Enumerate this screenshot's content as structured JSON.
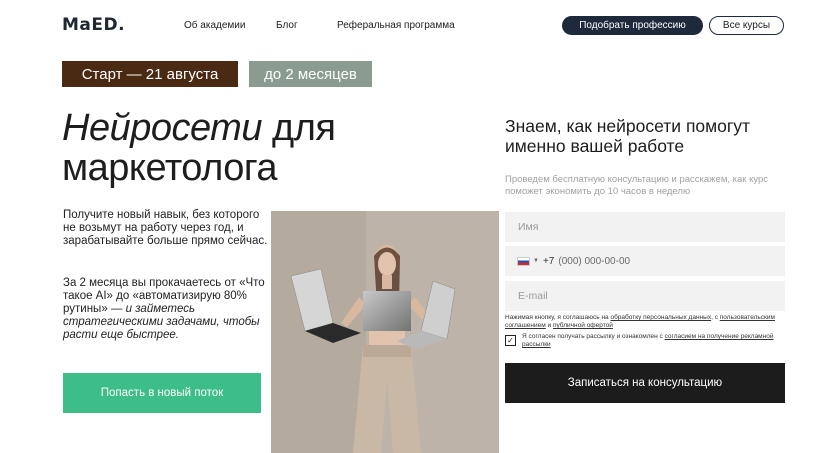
{
  "header": {
    "logo": "MaED.",
    "nav": [
      "Об академии",
      "Блог",
      "Реферальная программа"
    ],
    "choose_profession": "Подобрать профессию",
    "all_courses": "Все курсы"
  },
  "tags": {
    "start": "Старт —  21 августа",
    "duration": "до 2 месяцев"
  },
  "hero": {
    "title_italic": "Нейросети",
    "title_rest": " для",
    "title_line2": "маркетолога",
    "intro": "Получите новый навык, без которого не возьмут на работу через год, и зарабатывайте больше прямо сейчас.",
    "intro2_plain": "За 2 месяца вы прокачаетесь от «Что такое AI» до «автоматизирую 80% рутины» — ",
    "intro2_italic": "и займетесь стратегическими задачами, чтобы расти еще быстрее.",
    "cta": "Попасть в новый поток"
  },
  "form": {
    "title": "Знаем, как нейросети помогут именно вашей работе",
    "subtitle": "Проведем бесплатную консультацию и расскажем, как курс поможет экономить до 10 часов в неделю",
    "name_placeholder": "Имя",
    "phone_code": "+7",
    "phone_placeholder": "(000) 000-00-00",
    "email_placeholder": "E-mail",
    "consent_prefix": "Нажимая кнопку, я соглашаюсь на ",
    "consent_link1": "обработку персональных данных",
    "consent_mid": ", с ",
    "consent_link2": "пользовательским соглашением",
    "consent_and": " и ",
    "consent_link3": "публичной офертой",
    "newsletter_prefix": "Я согласен получать рассылку и ознакомлен с ",
    "newsletter_link": "согласием на получение рекламной рассылки",
    "newsletter_checked": true,
    "submit": "Записаться на консультацию"
  }
}
